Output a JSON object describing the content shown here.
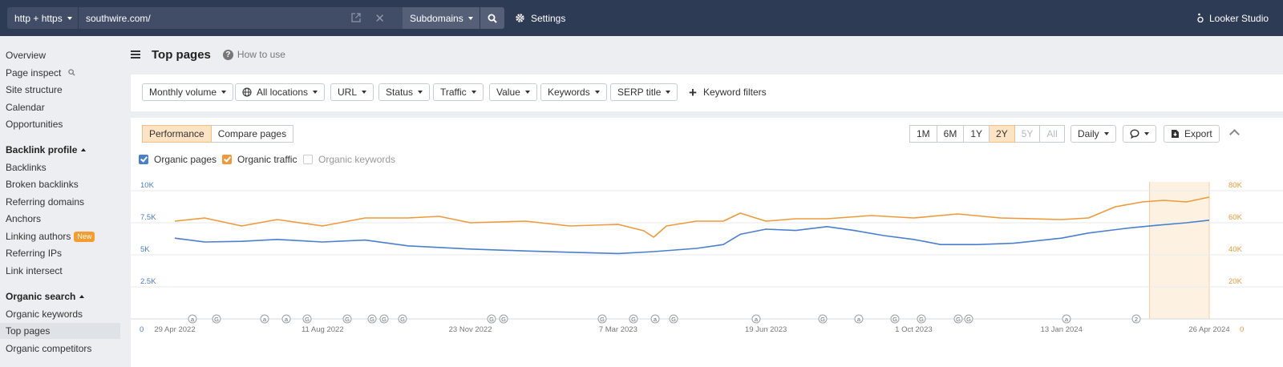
{
  "topbar": {
    "protocol": "http + https",
    "url": "southwire.com/",
    "mode": "Subdomains",
    "settings_label": "Settings",
    "looker_label": "Looker Studio"
  },
  "sidebar": {
    "items": [
      {
        "label": "Overview",
        "type": "item"
      },
      {
        "label": "Page inspect",
        "type": "item",
        "icon": "search-icon"
      },
      {
        "label": "Site structure",
        "type": "item"
      },
      {
        "label": "Calendar",
        "type": "item"
      },
      {
        "label": "Opportunities",
        "type": "item"
      },
      {
        "label": "Backlink profile",
        "type": "header"
      },
      {
        "label": "Backlinks",
        "type": "item"
      },
      {
        "label": "Broken backlinks",
        "type": "item"
      },
      {
        "label": "Referring domains",
        "type": "item"
      },
      {
        "label": "Anchors",
        "type": "item"
      },
      {
        "label": "Linking authors",
        "type": "item",
        "badge": "New"
      },
      {
        "label": "Referring IPs",
        "type": "item"
      },
      {
        "label": "Link intersect",
        "type": "item"
      },
      {
        "label": "Organic search",
        "type": "header"
      },
      {
        "label": "Organic keywords",
        "type": "item"
      },
      {
        "label": "Top pages",
        "type": "item",
        "active": true
      },
      {
        "label": "Organic competitors",
        "type": "item"
      }
    ]
  },
  "page": {
    "title": "Top pages",
    "how_to": "How to use"
  },
  "filters": {
    "buttons": [
      "Monthly volume",
      "All locations",
      "URL",
      "Status",
      "Traffic",
      "Value",
      "Keywords",
      "SERP title"
    ],
    "keyword_filters": "Keyword filters"
  },
  "chart_controls": {
    "tabs": [
      "Performance",
      "Compare pages"
    ],
    "active_tab": "Performance",
    "ranges": [
      "1M",
      "6M",
      "1Y",
      "2Y",
      "5Y",
      "All"
    ],
    "active_range": "2Y",
    "disabled_ranges": [
      "5Y",
      "All"
    ],
    "interval": "Daily",
    "export_label": "Export"
  },
  "colors": {
    "pages": "#4a7fcf",
    "traffic": "#ee9a3a",
    "accent": "#f59c2d",
    "topbar": "#2e3b55"
  },
  "chart_data": {
    "type": "line",
    "title": "",
    "xlabel": "",
    "x_ticks": [
      "29 Apr 2022",
      "11 Aug 2022",
      "23 Nov 2022",
      "7 Mar 2023",
      "19 Jun 2023",
      "1 Oct 2023",
      "13 Jan 2024",
      "26 Apr 2024"
    ],
    "y_left": {
      "ticks": [
        "0",
        "2.5K",
        "5K",
        "7.5K",
        "10K"
      ],
      "range": [
        0,
        10000
      ]
    },
    "y_right": {
      "ticks": [
        "0",
        "20K",
        "40K",
        "60K",
        "80K"
      ],
      "range": [
        0,
        80000
      ]
    },
    "grid": true,
    "legend": [
      {
        "name": "Organic pages",
        "checked": true,
        "color": "#4a7fcf"
      },
      {
        "name": "Organic traffic",
        "checked": true,
        "color": "#ee9a3a"
      },
      {
        "name": "Organic keywords",
        "checked": false
      }
    ],
    "series": [
      {
        "name": "Organic pages",
        "axis": "left",
        "x": [
          "2022-04-29",
          "2022-05-20",
          "2022-06-15",
          "2022-07-10",
          "2022-08-11",
          "2022-09-10",
          "2022-10-10",
          "2022-11-23",
          "2023-01-01",
          "2023-02-01",
          "2023-03-07",
          "2023-04-01",
          "2023-05-01",
          "2023-05-20",
          "2023-06-01",
          "2023-06-19",
          "2023-07-10",
          "2023-08-01",
          "2023-08-20",
          "2023-09-10",
          "2023-10-01",
          "2023-10-20",
          "2023-11-15",
          "2023-12-10",
          "2024-01-13",
          "2024-02-01",
          "2024-03-01",
          "2024-03-20",
          "2024-04-10",
          "2024-04-26"
        ],
        "values": [
          6300,
          6000,
          6050,
          6200,
          6000,
          6150,
          5700,
          5450,
          5300,
          5200,
          5100,
          5250,
          5500,
          5800,
          6600,
          7000,
          6900,
          7200,
          6900,
          6500,
          6200,
          5800,
          5800,
          5900,
          6300,
          6700,
          7100,
          7300,
          7500,
          7700
        ]
      },
      {
        "name": "Organic traffic",
        "axis": "right",
        "x": [
          "2022-04-29",
          "2022-05-20",
          "2022-06-15",
          "2022-07-10",
          "2022-08-11",
          "2022-09-10",
          "2022-10-10",
          "2022-11-01",
          "2022-11-23",
          "2023-01-01",
          "2023-02-01",
          "2023-03-07",
          "2023-03-25",
          "2023-04-01",
          "2023-04-10",
          "2023-05-01",
          "2023-05-20",
          "2023-06-01",
          "2023-06-19",
          "2023-07-10",
          "2023-08-01",
          "2023-09-01",
          "2023-10-01",
          "2023-11-01",
          "2023-12-01",
          "2024-01-13",
          "2024-02-01",
          "2024-02-20",
          "2024-03-10",
          "2024-03-25",
          "2024-04-10",
          "2024-04-26"
        ],
        "values": [
          61000,
          62000,
          59000,
          61000,
          59000,
          62000,
          64000,
          63000,
          61000,
          60000,
          59000,
          58000,
          56000,
          50000,
          59000,
          60000,
          62000,
          65000,
          62000,
          61500,
          63500,
          63500,
          64000,
          64500,
          64000,
          61000,
          64000,
          69000,
          74000,
          73000,
          74000,
          76000
        ]
      }
    ],
    "annotations": [
      "a",
      "G",
      "a",
      "a",
      "G",
      "G",
      "G",
      "G",
      "G",
      "G",
      "G",
      "G",
      "G",
      "a",
      "G",
      "a",
      "G",
      "a",
      "G",
      "G",
      "G",
      "G",
      "a",
      "2"
    ],
    "highlight": {
      "from": "2024-03-15",
      "to": "2024-04-26"
    }
  }
}
